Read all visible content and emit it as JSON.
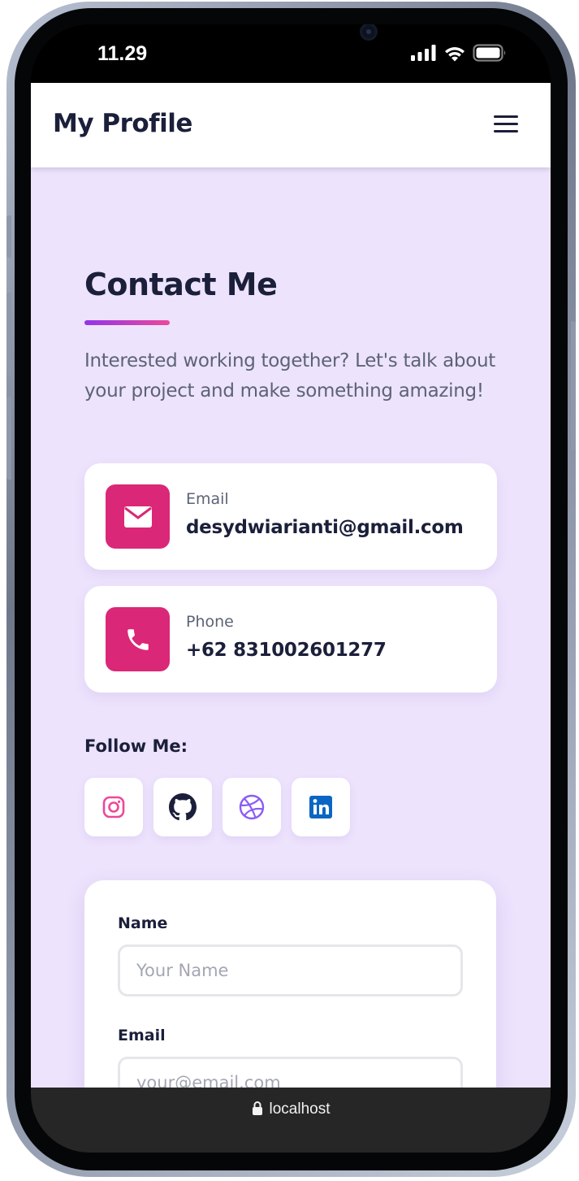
{
  "status_bar": {
    "time": "11.29",
    "icons": [
      "signal-icon",
      "wifi-icon",
      "battery-icon"
    ]
  },
  "header": {
    "title": "My Profile",
    "menu_icon": "hamburger-menu-icon"
  },
  "contact": {
    "title": "Contact Me",
    "intro": "Interested working together? Let's talk about your project and make something amazing!",
    "items": [
      {
        "icon": "envelope-icon",
        "label": "Email",
        "value": "desydwiarianti@gmail.com"
      },
      {
        "icon": "phone-icon",
        "label": "Phone",
        "value": "+62 831002601277"
      }
    ],
    "follow_label": "Follow Me:",
    "socials": [
      {
        "icon": "instagram-icon",
        "color": "#ec4899"
      },
      {
        "icon": "github-icon",
        "color": "#1b1f3a"
      },
      {
        "icon": "dribbble-icon",
        "color": "#8b5cf6"
      },
      {
        "icon": "linkedin-icon",
        "color": "#0a66c2"
      }
    ]
  },
  "form": {
    "fields": [
      {
        "label": "Name",
        "placeholder": "Your Name"
      },
      {
        "label": "Email",
        "placeholder": "your@email.com"
      }
    ]
  },
  "browser": {
    "url": "localhost"
  },
  "colors": {
    "accent": "#db2777",
    "background": "#ede3fd",
    "text_dark": "#1b1f3a",
    "gradient_start": "#9333ea",
    "gradient_end": "#ec4899"
  }
}
